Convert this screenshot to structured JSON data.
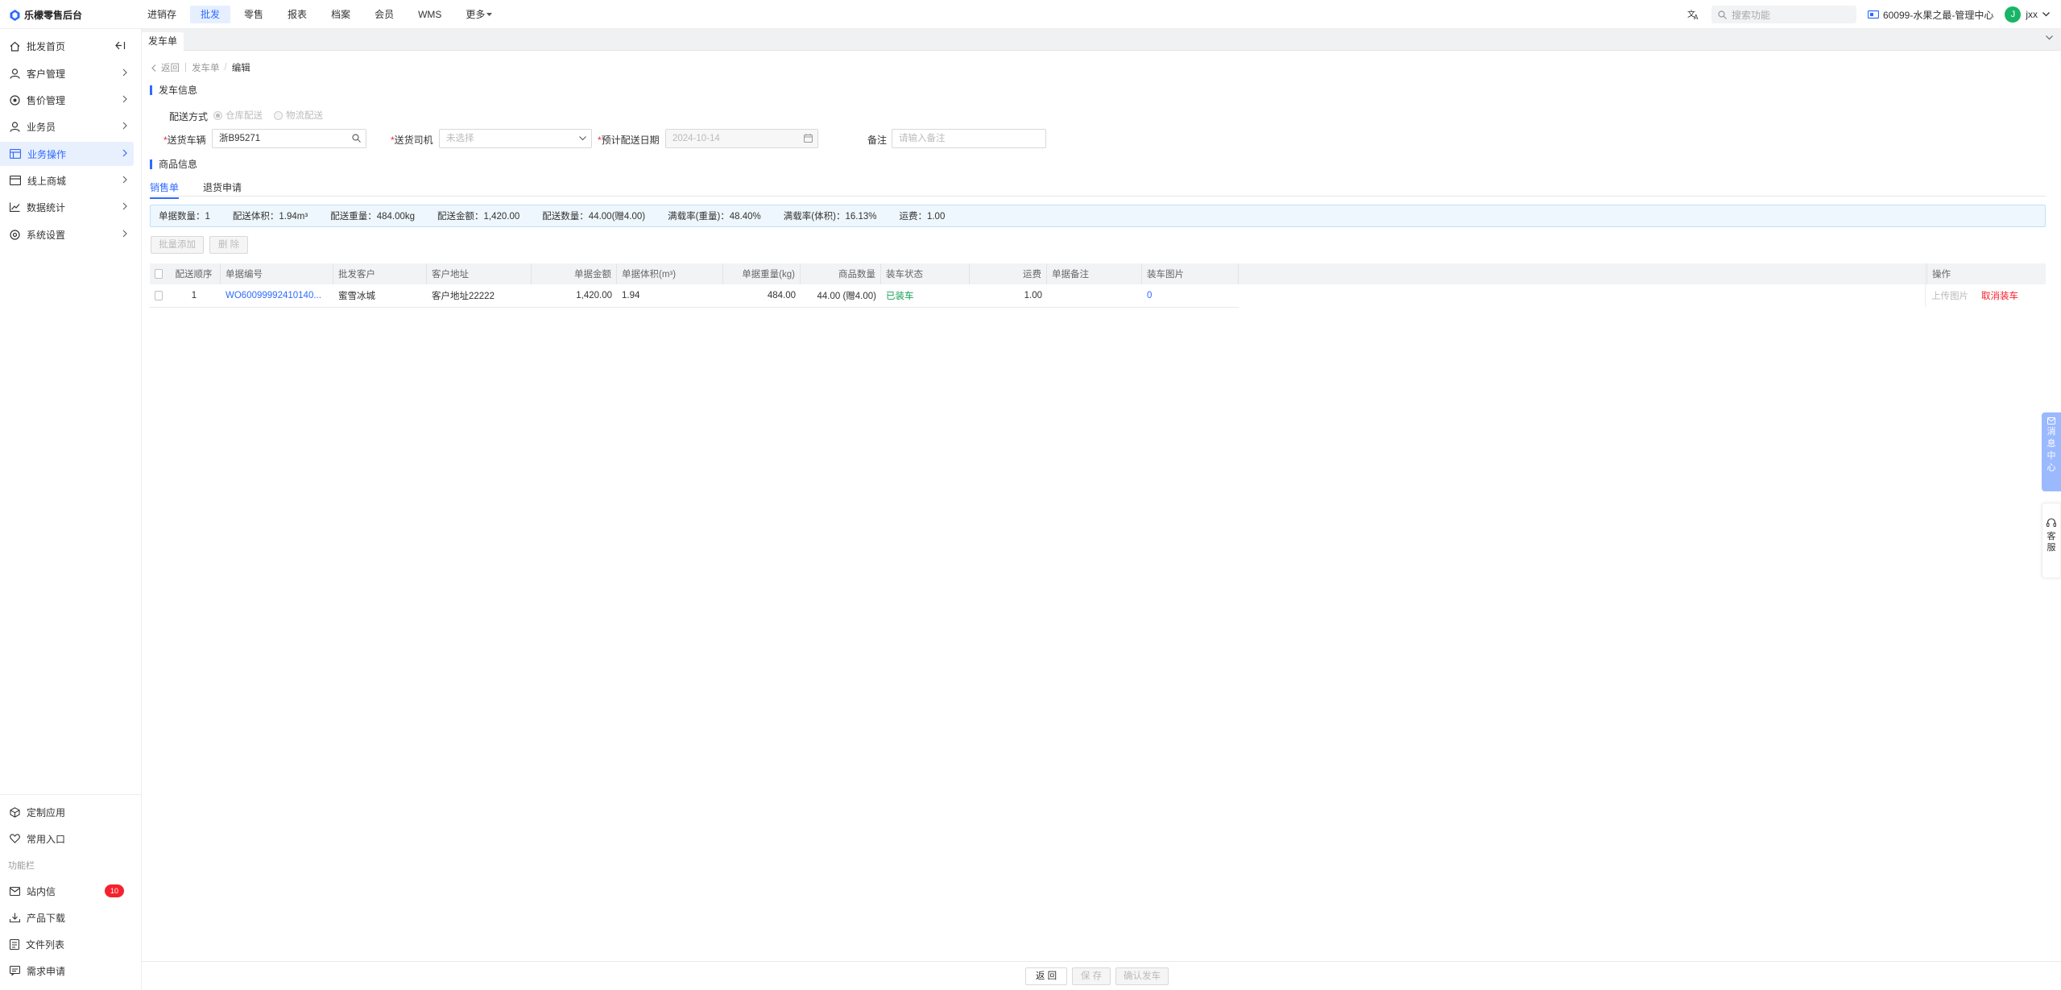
{
  "app": {
    "logo_text": "乐檬零售后台",
    "nav": [
      "进销存",
      "批发",
      "零售",
      "报表",
      "档案",
      "会员",
      "WMS",
      "更多"
    ],
    "active_nav": "批发",
    "search_placeholder": "搜索功能",
    "store": "60099-水果之最-管理中心",
    "user_initial": "J",
    "username": "jxx"
  },
  "sidebar": {
    "items": [
      {
        "label": "批发首页",
        "icon": "home-icon"
      },
      {
        "label": "客户管理",
        "icon": "user-icon"
      },
      {
        "label": "售价管理",
        "icon": "price-icon"
      },
      {
        "label": "业务员",
        "icon": "person-icon"
      },
      {
        "label": "业务操作",
        "icon": "operation-icon"
      },
      {
        "label": "线上商城",
        "icon": "shop-icon"
      },
      {
        "label": "数据统计",
        "icon": "chart-icon"
      },
      {
        "label": "系统设置",
        "icon": "settings-icon"
      }
    ],
    "bottom": [
      {
        "label": "定制应用",
        "icon": "cube-icon"
      },
      {
        "label": "常用入口",
        "icon": "heart-icon"
      }
    ],
    "func_label": "功能栏",
    "func_items": [
      {
        "label": "站内信",
        "icon": "mail-icon",
        "badge": "10"
      },
      {
        "label": "产品下载",
        "icon": "download-icon"
      },
      {
        "label": "文件列表",
        "icon": "file-list-icon"
      },
      {
        "label": "需求申请",
        "icon": "request-icon"
      }
    ]
  },
  "tab": {
    "label": "发车单"
  },
  "breadcrumb": {
    "back": "返回",
    "parent": "发车单",
    "sep": "/",
    "current": "编辑"
  },
  "section_dispatch": "发车信息",
  "form": {
    "delivery_method_label": "配送方式",
    "option_warehouse": "仓库配送",
    "option_logistics": "物流配送",
    "vehicle_label": "送货车辆",
    "vehicle_value": "浙B95271",
    "driver_label": "送货司机",
    "driver_value": "未选择",
    "date_label": "预计配送日期",
    "date_value": "2024-10-14",
    "remark_label": "备注",
    "remark_placeholder": "请输入备注"
  },
  "section_goods": "商品信息",
  "subtabs": [
    "销售单",
    "退货申请"
  ],
  "summary": [
    "单据数量：1",
    "配送体积：1.94m³",
    "配送重量：484.00kg",
    "配送金额：1,420.00",
    "配送数量：44.00(赠4.00)",
    "满载率(重量)：48.40%",
    "满载率(体积)：16.13%",
    "运费：1.00"
  ],
  "buttons": {
    "batch_add": "批量添加",
    "delete": "删 除"
  },
  "table": {
    "headers": [
      "配送顺序",
      "单据编号",
      "批发客户",
      "客户地址",
      "单据金额",
      "单据体积(m³)",
      "单据重量(kg)",
      "商品数量",
      "装车状态",
      "运费",
      "单据备注",
      "装车图片",
      "操作"
    ],
    "rows": [
      {
        "seq": "1",
        "doc_no": "WO60099992410140...",
        "customer": "蜜雪冰城",
        "address": "客户地址22222",
        "amount": "1,420.00",
        "volume": "1.94",
        "weight": "484.00",
        "qty": "44.00 (赠4.00)",
        "status": "已装车",
        "freight": "1.00",
        "remark": "",
        "images": "0",
        "op_upload": "上传图片",
        "op_cancel": "取消装车"
      }
    ]
  },
  "footer": {
    "back": "返 回",
    "save": "保 存",
    "confirm": "确认发车"
  },
  "float": {
    "msg": [
      "消",
      "息",
      "中",
      "心"
    ],
    "service": [
      "客",
      "服"
    ]
  },
  "colors": {
    "primary": "#2f6bff",
    "success": "#18a058",
    "danger": "#f5222d"
  }
}
